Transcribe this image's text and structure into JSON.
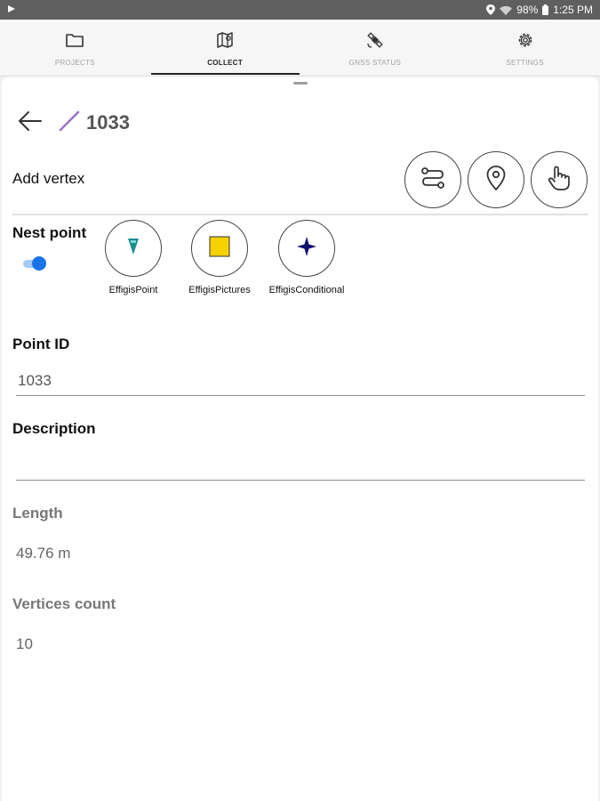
{
  "status_bar": {
    "battery": "98%",
    "time": "1:25 PM"
  },
  "tabs": [
    {
      "label": "PROJECTS",
      "icon": "folder-icon",
      "active": false
    },
    {
      "label": "COLLECT",
      "icon": "map-icon",
      "active": true
    },
    {
      "label": "GNSS STATUS",
      "icon": "satellite-icon",
      "active": false
    },
    {
      "label": "SETTINGS",
      "icon": "gear-icon",
      "active": false
    }
  ],
  "feature": {
    "title": "1033",
    "geometry_icon": "line-icon",
    "line_color": "#9b72c8"
  },
  "vertex": {
    "label": "Add vertex",
    "actions": [
      "route-icon",
      "location-pin-icon",
      "touch-hand-icon"
    ]
  },
  "nest_point": {
    "label": "Nest point",
    "enabled": true,
    "templates": [
      {
        "label": "EffigisPoint",
        "icon": "teal-marker-icon",
        "color": "#1a8f8f"
      },
      {
        "label": "EffigisPictures",
        "icon": "yellow-square-icon",
        "color": "#f5d100"
      },
      {
        "label": "EffigisConditional",
        "icon": "navy-star-icon",
        "color": "#10106e"
      }
    ]
  },
  "fields": {
    "point_id": {
      "label": "Point ID",
      "value": "1033"
    },
    "description": {
      "label": "Description",
      "value": ""
    },
    "length": {
      "label": "Length",
      "value": "49.76 m"
    },
    "vertices_count": {
      "label": "Vertices count",
      "value": "10"
    }
  },
  "colors": {
    "accent": "#1a73e8",
    "status_bar": "#5f5f5f"
  }
}
